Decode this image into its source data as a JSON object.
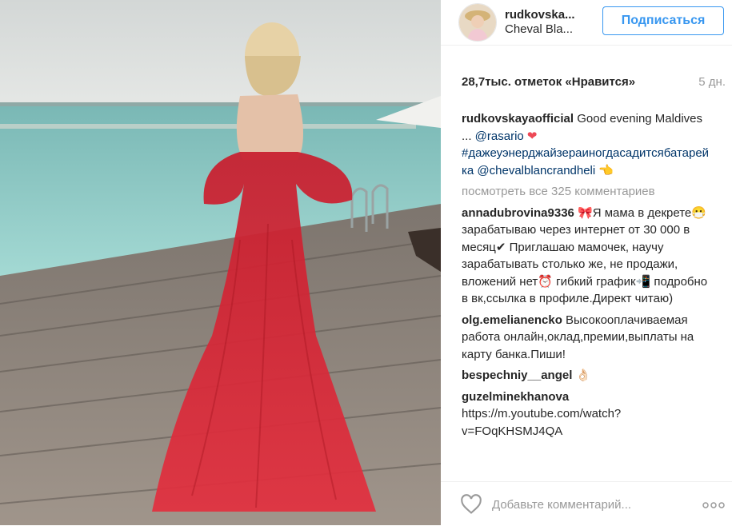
{
  "header": {
    "username": "rudkovska...",
    "location": "Cheval Bla...",
    "follow_label": "Подписаться"
  },
  "post": {
    "likes": "28,7тыс. отметок «Нравится»",
    "age": "5 дн.",
    "caption": {
      "user": "rudkovskayaofficial",
      "text1": " Good evening Maldives ... ",
      "mention1": "@rasario",
      "heart": "❤",
      "hashtag": "#дажеуэнерджайзераиногдасадитсябатарейка",
      "mention2": "@chevalblancrandheli",
      "emoji": "👈"
    },
    "view_all": "посмотреть все 325 комментариев",
    "comments": [
      {
        "user": "annadubrovina9336",
        "text": " 🎀Я мама в декрете😷 зарабатываю через интернет от 30 000 в месяц✔ Приглашаю мамочек, научу зарабатывать столько же, не продажи, вложений нет⏰ гибкий график📲 подробно в вк,ссылка в профиле.Директ читаю)"
      },
      {
        "user": "olg.emelianencko",
        "text": " Высокооплачиваемая работа онлайн,оклад,премии,выплаты на карту банка.Пиши!"
      },
      {
        "user": "bespechniy__angel",
        "text": " 👌🏻"
      },
      {
        "user": "guzelminekhanova",
        "text": " ",
        "link": "https://m.youtube.com/watch?v=FOqKHSMJ4QA"
      }
    ]
  },
  "footer": {
    "comment_placeholder": "Добавьте комментарий...",
    "like_icon": "heart-outline-icon",
    "more_icon": "ellipsis-icon"
  },
  "colors": {
    "accent": "#3897f0",
    "link": "#003569",
    "muted": "#999999",
    "heart": "#ed4956"
  }
}
